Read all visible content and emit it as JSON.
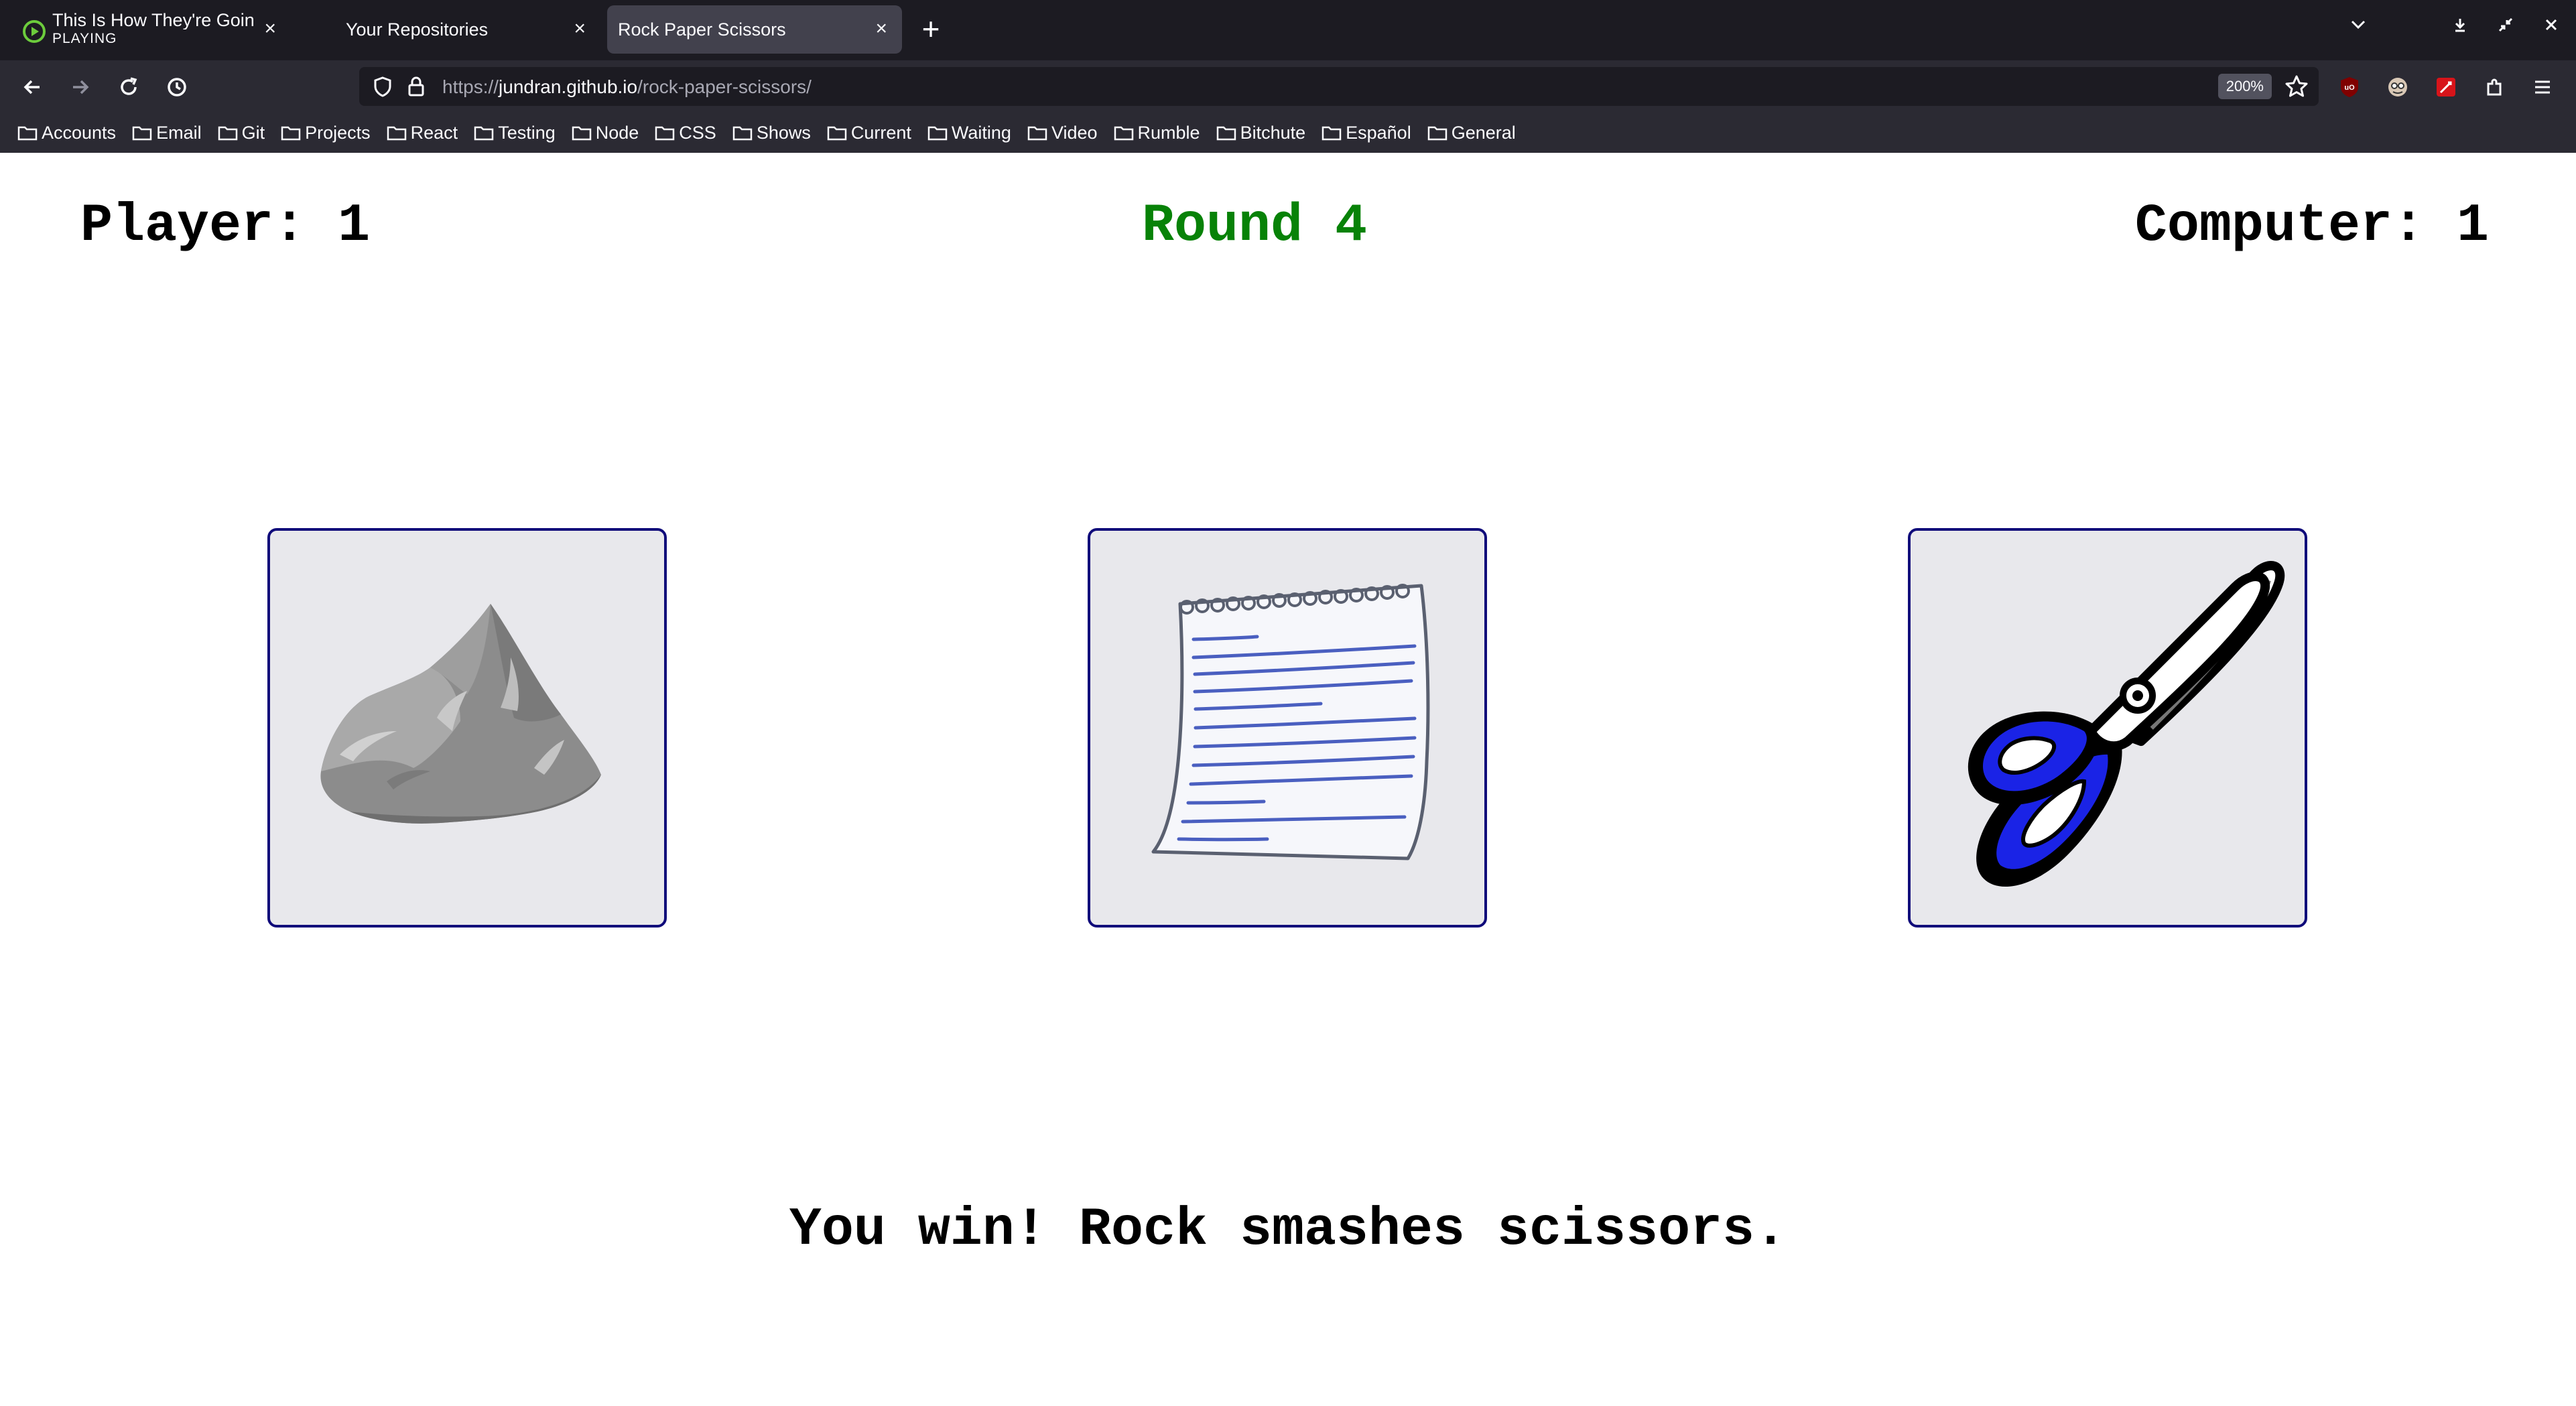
{
  "browser": {
    "tabs": [
      {
        "title": "This Is How They're Going T",
        "subtitle": "PLAYING",
        "close": "×"
      },
      {
        "title": "Your Repositories",
        "close": "×"
      },
      {
        "title": "Rock Paper Scissors",
        "close": "×",
        "active": true
      }
    ],
    "new_tab": "+",
    "url_prefix": "https://",
    "url_host": "jundran.github.io",
    "url_path": "/rock-paper-scissors/",
    "zoom": "200%",
    "bookmarks": [
      "Accounts",
      "Email",
      "Git",
      "Projects",
      "React",
      "Testing",
      "Node",
      "CSS",
      "Shows",
      "Current",
      "Waiting",
      "Video",
      "Rumble",
      "Bitchute",
      "Español",
      "General"
    ],
    "colors": {
      "chrome": "#2b2a33",
      "tabstrip": "#1c1b22",
      "active_tab": "#42414d"
    }
  },
  "game": {
    "player_score": "Player: 1",
    "round": "Round 4",
    "computer_score": "Computer: 1",
    "choices": [
      {
        "name": "rock",
        "icon": "rock-icon"
      },
      {
        "name": "paper",
        "icon": "paper-icon"
      },
      {
        "name": "scissors",
        "icon": "scissors-icon"
      }
    ],
    "result": "You win! Rock smashes scissors.",
    "colors": {
      "round": "#078207",
      "card_border": "#0f0a7a",
      "card_bg": "#e8e8ec",
      "scissors_handle": "#1a23e6"
    }
  }
}
